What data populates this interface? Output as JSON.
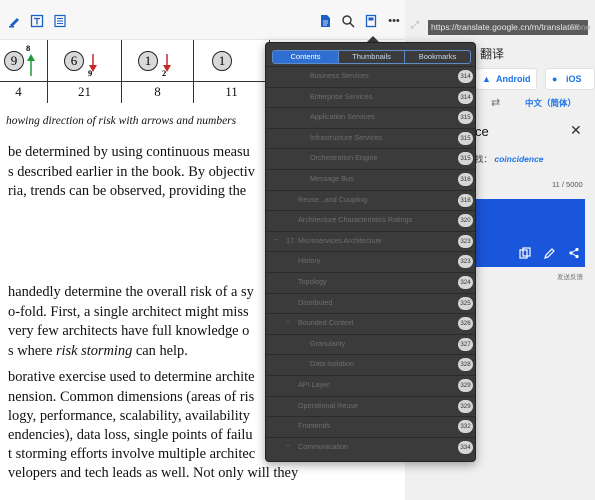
{
  "reader": {
    "risk_table": [
      {
        "value": "4",
        "circle": "9",
        "arrow": "up",
        "arrow_color": "#1f9a3a",
        "sub": "8"
      },
      {
        "value": "21",
        "circle": "6",
        "arrow": "down",
        "arrow_color": "#c62828",
        "sub": "9"
      },
      {
        "value": "8",
        "circle": "1",
        "arrow": "down",
        "arrow_color": "#c62828",
        "sub": "2"
      },
      {
        "value": "11",
        "circle": "1",
        "arrow": "",
        "arrow_color": "",
        "sub": ""
      }
    ],
    "caption": "howing direction of risk with arrows and numbers",
    "paragraph1": [
      "be determined by using continuous measu",
      "s described earlier in the book. By objectiv",
      "ria, trends can be observed, providing the"
    ],
    "paragraph2": [
      "handedly determine the overall risk of a sy",
      "o-fold. First, a single architect might miss",
      "very few architects have full knowledge o"
    ],
    "paragraph2_last_pre": "s where ",
    "paragraph2_last_italic": "risk storming",
    "paragraph2_last_post": " can help.",
    "paragraph3": [
      "borative exercise used to determine archite",
      "nension. Common dimensions (areas of ris",
      "logy, performance, scalability, availability",
      "endencies), data loss, single points of failu",
      "t storming efforts involve multiple architec",
      "velopers and tech leads as well. Not only will they"
    ]
  },
  "outline": {
    "tabs": [
      "Contents",
      "Thumbnails",
      "Bookmarks"
    ],
    "active_tab": "Contents",
    "items": [
      {
        "label": "Business Services",
        "page": "314",
        "indent": 2
      },
      {
        "label": "Enterprise Services",
        "page": "314",
        "indent": 2
      },
      {
        "label": "Application Services",
        "page": "315",
        "indent": 2
      },
      {
        "label": "Infrastructure Services",
        "page": "315",
        "indent": 2
      },
      {
        "label": "Orchestration Engine",
        "page": "315",
        "indent": 2
      },
      {
        "label": "Message Bus",
        "page": "316",
        "indent": 2
      },
      {
        "label": "Reuse...and Coupling",
        "page": "318",
        "indent": 1
      },
      {
        "label": "Architecture Characteristics Ratings",
        "page": "320",
        "indent": 1
      },
      {
        "label": "17. Microservices Architecture",
        "page": "323",
        "indent": 0,
        "toggle": "–"
      },
      {
        "label": "History",
        "page": "323",
        "indent": 1
      },
      {
        "label": "Topology",
        "page": "324",
        "indent": 1
      },
      {
        "label": "Distributed",
        "page": "325",
        "indent": 1
      },
      {
        "label": "Bounded Context",
        "page": "326",
        "indent": 1,
        "toggle": "–"
      },
      {
        "label": "Granularity",
        "page": "327",
        "indent": 2
      },
      {
        "label": "Data Isolation",
        "page": "328",
        "indent": 2
      },
      {
        "label": "API Layer",
        "page": "329",
        "indent": 1
      },
      {
        "label": "Operational Reuse",
        "page": "329",
        "indent": 1
      },
      {
        "label": "Frontends",
        "page": "332",
        "indent": 1
      },
      {
        "label": "Communication",
        "page": "334",
        "indent": 1,
        "toggle": "–"
      }
    ]
  },
  "translate": {
    "url": "https://translate.google.cn/m/translate#",
    "done_label": "Done",
    "title": "翻译",
    "android_label": "Android",
    "ios_label": "iOS",
    "target_lang": "中文（简体）",
    "source_text": "ce",
    "suggest_prefix": "找：",
    "suggestion": "coincidence",
    "char_count": "11 / 5000",
    "feedback": "发送反馈"
  },
  "colors": {
    "accent": "#1a73e8",
    "card": "#1a56db",
    "popup_bg": "#3b3b3b",
    "seg_active": "#2f6fd1"
  }
}
